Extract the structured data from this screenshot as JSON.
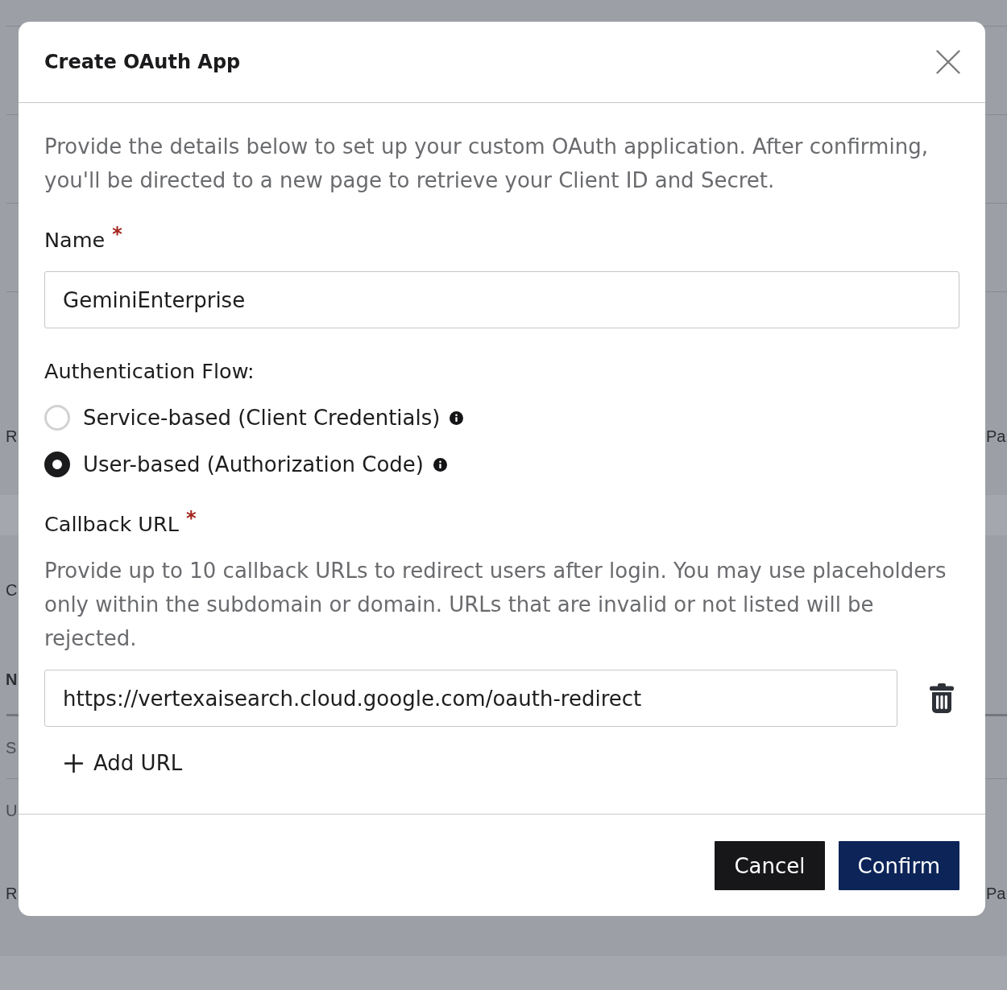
{
  "background_page": {
    "sections": [
      {
        "kind": "blank"
      },
      {
        "kind": "blank"
      },
      {
        "kind": "blank"
      },
      {
        "kind": "blank"
      },
      {
        "kind": "tall",
        "left": "R",
        "right": "Pa"
      },
      {
        "kind": "band"
      },
      {
        "kind": "heading",
        "left": "C"
      },
      {
        "kind": "table_head",
        "left": "N"
      },
      {
        "kind": "table_row",
        "left": "S"
      },
      {
        "kind": "table_row_end",
        "left": "U"
      },
      {
        "kind": "tall_end",
        "left": "R",
        "right": "Pa"
      },
      {
        "kind": "footer_band"
      }
    ]
  },
  "dialog": {
    "title": "Create OAuth App",
    "description": "Provide the details below to set up your custom OAuth application. After confirming, you'll be directed to a new page to retrieve your Client ID and Secret.",
    "name_field": {
      "label": "Name",
      "required_mark": "*",
      "value": "GeminiEnterprise"
    },
    "auth_flow": {
      "label": "Authentication Flow:",
      "options": [
        {
          "label": "Service-based (Client Credentials)",
          "selected": false
        },
        {
          "label": "User-based (Authorization Code)",
          "selected": true
        }
      ]
    },
    "callback": {
      "label": "Callback URL",
      "required_mark": "*",
      "help": "Provide up to 10 callback URLs to redirect users after login. You may use placeholders only within the subdomain or domain. URLs that are invalid or not listed will be rejected.",
      "urls": [
        {
          "value": "https://vertexaisearch.cloud.google.com/oauth-redirect"
        }
      ],
      "add_button": "Add URL"
    },
    "buttons": [
      {
        "kind": "secondary",
        "label": "Cancel"
      },
      {
        "kind": "primary",
        "label": "Confirm"
      }
    ]
  }
}
